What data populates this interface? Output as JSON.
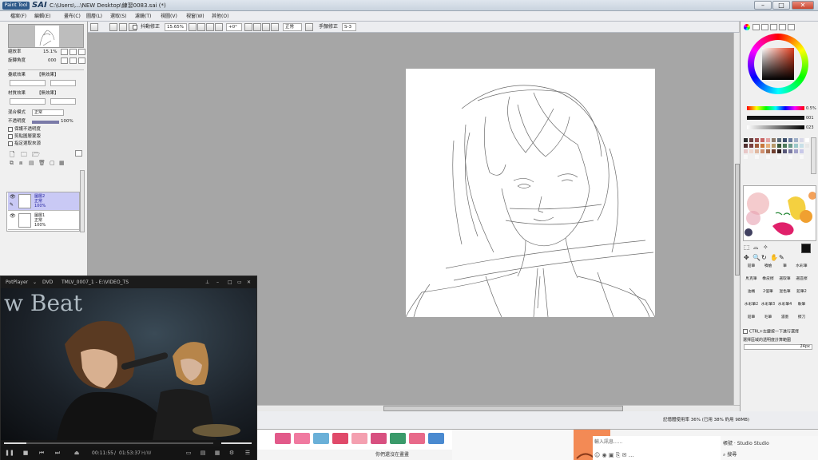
{
  "titlebar": {
    "logo": "Paint Tool",
    "app_name": "SAI",
    "window_title": "C:\\Users\\...\\NEW Desktop\\練習0083.sai (*)",
    "min": "–",
    "max": "□",
    "close": "✕"
  },
  "menu": [
    "檔案(F)",
    "編輯(E)",
    "畫布(C)",
    "圖層(L)",
    "選取(S)",
    "濾鏡(T)",
    "視圖(V)",
    "視窗(W)",
    "其他(O)"
  ],
  "navigator": {
    "zoom_label": "縮放率",
    "zoom_value": "15.1%",
    "angle_label": "旋轉角度",
    "angle_value": "000"
  },
  "layer_panel": {
    "blend_label1": "疊紙效果",
    "blend_value1": "【無效果】",
    "blend_label2": "材質效果",
    "blend_value2": "【無效果】",
    "mode_label": "混合模式",
    "mode_value": "正常",
    "opacity_label": "不透明度",
    "opacity_value": "100%",
    "check1": "保護不透明度",
    "check2": "剪貼圖層蒙版",
    "check3": "指定選取來源",
    "layers": [
      {
        "name": "圖層2",
        "mode": "正常",
        "opacity": "100%"
      },
      {
        "name": "圖層1",
        "mode": "正常",
        "opacity": "100%"
      }
    ]
  },
  "toolbar": {
    "stabilize": "抖動修正",
    "zoom": "15.65%",
    "angle": "+0°",
    "mode": "正常",
    "stabilizer_label": "手顫修正",
    "stabilizer_value": "S-3"
  },
  "color_panel": {
    "slider1": "0.5%",
    "slider2": "001",
    "slider3": "023"
  },
  "swatch_colors": [
    "#2b2b2b",
    "#6b3f3f",
    "#9c5050",
    "#c86464",
    "#e3a3a3",
    "#8c7a6a",
    "#5a6b7a",
    "#3c4e6a",
    "#6a7ca0",
    "#a0b0c8",
    "#d8d8e8",
    "#ffffff",
    "#503030",
    "#7a4040",
    "#a05a3a",
    "#c8783c",
    "#e6b07a",
    "#b89a6a",
    "#3a5a3a",
    "#4e7a5a",
    "#6a9a8a",
    "#9ac8c8",
    "#c8e0e8",
    "#e8e8e8",
    "#e8c8c8",
    "#f0d8d0",
    "#e0b8a0",
    "#d09070",
    "#a0684a",
    "#704030",
    "#302020",
    "#585878",
    "#7878a0",
    "#a0a0c8",
    "#c8c8e8",
    "#f0f0f0",
    "#f8f8f8",
    "#f0f0f0",
    "#f8f8f8",
    "#f0f0f0",
    "#f8f8f8",
    "#f0f0f0",
    "#f8f8f8",
    "#f0f0f0",
    "#f8f8f8",
    "#f0f0f0",
    "#f8f8f8",
    "#f0f0f0"
  ],
  "tools": {
    "row1": [
      "鉛筆",
      "噴槍",
      "筆",
      "水彩筆"
    ],
    "row2": [
      "馬克筆",
      "橡皮擦",
      "選取筆",
      "選區擦"
    ],
    "row3": [
      "油桶",
      "2值筆",
      "混色筆",
      "鉛筆2"
    ],
    "row4": [
      "水彩筆2",
      "水彩筆3",
      "水彩筆4",
      "軟筆"
    ],
    "row5": [
      "鉛筆",
      "毛筆",
      "濃墨",
      "擦刀"
    ],
    "ctrl_hint": "CTRL+左鍵按一下進行選擇",
    "select_hint": "選擇區域的透明度計算範圍",
    "size_value": "24px"
  },
  "status": {
    "memory": "記憶體使用率 36% (已用 38% 約用 98MB)"
  },
  "taskbar": {
    "chat_placeholder": "輸入訊息......",
    "search": "搜尋",
    "user": "帳號 · Studio Studio",
    "bottom_text": "你們還沒在畫畫"
  },
  "potplayer": {
    "brand": "PotPlayer",
    "source": "DVD",
    "file": "TMLV_0007_1 - E:\\VIDEO_TS",
    "banner": "w Beat",
    "time": "00:11:55",
    "duration": "01:53:37",
    "codec": "H/W"
  }
}
